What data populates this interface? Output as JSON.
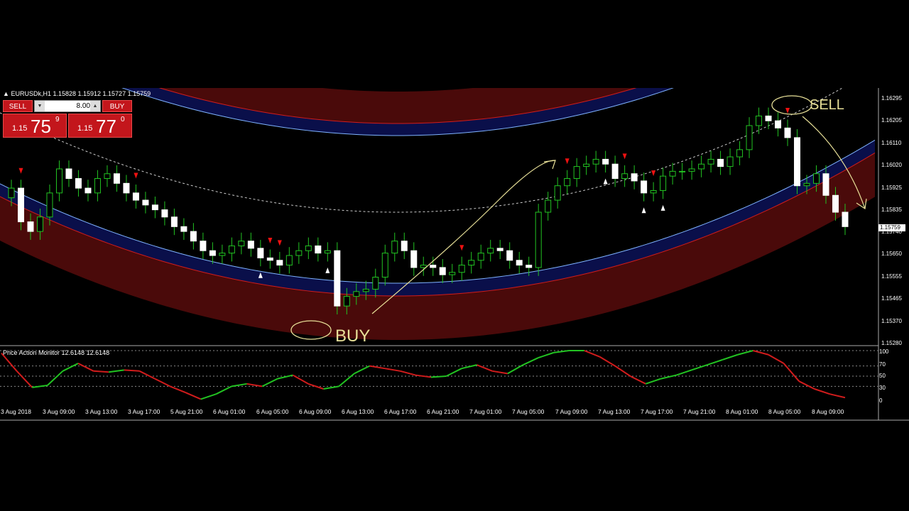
{
  "chart": {
    "symbol_title": "EURUSDk,H1",
    "ohlc": "1.15828 1.15912 1.15727 1.15759",
    "current_price": "1.15759"
  },
  "one_click": {
    "sell_label": "SELL",
    "buy_label": "BUY",
    "lot_value": "8.00",
    "sell_price": {
      "prefix": "1.15",
      "big": "75",
      "sup": "9"
    },
    "buy_price": {
      "prefix": "1.15",
      "big": "77",
      "sup": "0"
    }
  },
  "price_axis": [
    "1.16295",
    "1.16205",
    "1.16110",
    "1.16020",
    "1.15925",
    "1.15835",
    "1.15740",
    "1.15650",
    "1.15555",
    "1.15465",
    "1.15370",
    "1.15280"
  ],
  "indicator": {
    "title": "Price Action Monitor 12.6148 12.6148",
    "axis": [
      "100",
      "70",
      "50",
      "30",
      "0"
    ]
  },
  "time_axis": [
    "3 Aug 2018",
    "3 Aug 09:00",
    "3 Aug 13:00",
    "3 Aug 17:00",
    "5 Aug 21:00",
    "6 Aug 01:00",
    "6 Aug 05:00",
    "6 Aug 09:00",
    "6 Aug 13:00",
    "6 Aug 17:00",
    "6 Aug 21:00",
    "7 Aug 01:00",
    "7 Aug 05:00",
    "7 Aug 09:00",
    "7 Aug 13:00",
    "7 Aug 17:00",
    "7 Aug 21:00",
    "8 Aug 01:00",
    "8 Aug 05:00",
    "8 Aug 09:00"
  ],
  "annotations": {
    "buy": "BUY",
    "sell": "SELL"
  },
  "colors": {
    "bull": "#ffffff",
    "bear": "#ffffff",
    "wick": "#22c322",
    "band_red": "#4a0a0a",
    "band_blue": "#0a0f4a",
    "up_line": "#22c322",
    "down_line": "#d11c1c"
  },
  "chart_data": {
    "type": "candlestick",
    "opens": [
      1.1588,
      1.1592,
      1.1578,
      1.1574,
      1.158,
      1.159,
      1.16,
      1.1596,
      1.1592,
      1.159,
      1.1596,
      1.1598,
      1.1594,
      1.159,
      1.1587,
      1.1585,
      1.1583,
      1.158,
      1.1576,
      1.1574,
      1.157,
      1.1566,
      1.1564,
      1.1565,
      1.1568,
      1.157,
      1.1567,
      1.1563,
      1.1562,
      1.156,
      1.1564,
      1.1566,
      1.1568,
      1.1565,
      1.1566,
      1.1543,
      1.1547,
      1.1549,
      1.155,
      1.1555,
      1.1565,
      1.157,
      1.1566,
      1.1559,
      1.156,
      1.1559,
      1.1556,
      1.1557,
      1.156,
      1.1562,
      1.1565,
      1.1567,
      1.1566,
      1.1562,
      1.156,
      1.1559,
      1.1582,
      1.1587,
      1.1593,
      1.1596,
      1.1601,
      1.1602,
      1.1604,
      1.1602,
      1.1596,
      1.1598,
      1.1595,
      1.159,
      1.1591,
      1.1597,
      1.1599,
      1.1599,
      1.16,
      1.1602,
      1.1604,
      1.1601,
      1.1605,
      1.1608,
      1.1618,
      1.1622,
      1.162,
      1.1617,
      1.1613,
      1.1593,
      1.1594,
      1.1598,
      1.1589,
      1.1582
    ],
    "closes": [
      1.1592,
      1.1578,
      1.1574,
      1.158,
      1.159,
      1.16,
      1.1596,
      1.1592,
      1.159,
      1.1596,
      1.1598,
      1.1594,
      1.159,
      1.1587,
      1.1585,
      1.1583,
      1.158,
      1.1576,
      1.1574,
      1.157,
      1.1566,
      1.1564,
      1.1565,
      1.1568,
      1.157,
      1.1567,
      1.1563,
      1.1562,
      1.156,
      1.1564,
      1.1566,
      1.1568,
      1.1565,
      1.1566,
      1.1543,
      1.1547,
      1.1549,
      1.155,
      1.1555,
      1.1565,
      1.157,
      1.1566,
      1.1559,
      1.156,
      1.1559,
      1.1556,
      1.1557,
      1.156,
      1.1562,
      1.1565,
      1.1567,
      1.1566,
      1.1562,
      1.156,
      1.1559,
      1.1582,
      1.1587,
      1.1593,
      1.1596,
      1.1601,
      1.1602,
      1.1604,
      1.1602,
      1.1596,
      1.1598,
      1.1595,
      1.159,
      1.1591,
      1.1597,
      1.1599,
      1.1599,
      1.16,
      1.1602,
      1.1604,
      1.1601,
      1.1605,
      1.1608,
      1.1618,
      1.1622,
      1.162,
      1.1617,
      1.1613,
      1.1593,
      1.1594,
      1.1598,
      1.1589,
      1.1582,
      1.1576
    ],
    "indicator_values": [
      95,
      60,
      28,
      32,
      60,
      75,
      60,
      58,
      62,
      60,
      45,
      30,
      18,
      5,
      15,
      30,
      35,
      30,
      45,
      52,
      35,
      25,
      30,
      55,
      70,
      65,
      60,
      52,
      48,
      50,
      65,
      72,
      60,
      55,
      72,
      86,
      96,
      100,
      100,
      88,
      70,
      50,
      35,
      45,
      52,
      62,
      72,
      82,
      92,
      100,
      92,
      75,
      40,
      25,
      15,
      8
    ]
  }
}
